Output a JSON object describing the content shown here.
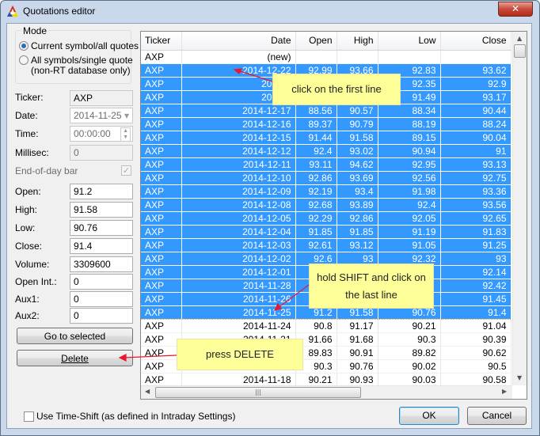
{
  "window": {
    "title": "Quotations editor",
    "close_label": "✕"
  },
  "mode": {
    "legend": "Mode",
    "options": [
      {
        "label": "Current symbol/all quotes",
        "selected": true
      },
      {
        "label": "All symbols/single quote",
        "label2": "(non-RT database only)",
        "selected": false
      }
    ]
  },
  "fields": {
    "ticker": {
      "label": "Ticker:",
      "value": "AXP"
    },
    "date": {
      "label": "Date:",
      "value": "2014-11-25"
    },
    "time": {
      "label": "Time:",
      "value": "00:00:00"
    },
    "millisec": {
      "label": "Millisec:",
      "value": "0"
    },
    "eod": {
      "label": "End-of-day bar",
      "checked": true
    },
    "open": {
      "label": "Open:",
      "value": "91.2"
    },
    "high": {
      "label": "High:",
      "value": "91.58"
    },
    "low": {
      "label": "Low:",
      "value": "90.76"
    },
    "close": {
      "label": "Close:",
      "value": "91.4"
    },
    "volume": {
      "label": "Volume:",
      "value": "3309600"
    },
    "openint": {
      "label": "Open Int.:",
      "value": "0"
    },
    "aux1": {
      "label": "Aux1:",
      "value": "0"
    },
    "aux2": {
      "label": "Aux2:",
      "value": "0"
    }
  },
  "buttons": {
    "goto": "Go to selected",
    "delete": "Delete",
    "ok": "OK",
    "cancel": "Cancel"
  },
  "timeshift": {
    "label": "Use Time-Shift (as defined in Intraday Settings)",
    "checked": false
  },
  "table": {
    "columns": [
      "Ticker",
      "Date",
      "Open",
      "High",
      "Low",
      "Close"
    ],
    "rows": [
      {
        "c": [
          "AXP",
          "(new)",
          "",
          "",
          "",
          ""
        ],
        "sel": false
      },
      {
        "c": [
          "AXP",
          "2014-12-22",
          "92.99",
          "93.66",
          "92.83",
          "93.62"
        ],
        "sel": true
      },
      {
        "c": [
          "AXP",
          "2014-1",
          "",
          "",
          "92.35",
          "92.9"
        ],
        "sel": true
      },
      {
        "c": [
          "AXP",
          "2014-1",
          "",
          "",
          "91.49",
          "93.17"
        ],
        "sel": true
      },
      {
        "c": [
          "AXP",
          "2014-12-17",
          "88.56",
          "90.57",
          "88.34",
          "90.44"
        ],
        "sel": true
      },
      {
        "c": [
          "AXP",
          "2014-12-16",
          "89.37",
          "90.79",
          "88.19",
          "88.24"
        ],
        "sel": true
      },
      {
        "c": [
          "AXP",
          "2014-12-15",
          "91.44",
          "91.58",
          "89.15",
          "90.04"
        ],
        "sel": true
      },
      {
        "c": [
          "AXP",
          "2014-12-12",
          "92.4",
          "93.02",
          "90.94",
          "91"
        ],
        "sel": true
      },
      {
        "c": [
          "AXP",
          "2014-12-11",
          "93.11",
          "94.62",
          "92.95",
          "93.13"
        ],
        "sel": true
      },
      {
        "c": [
          "AXP",
          "2014-12-10",
          "92.86",
          "93.69",
          "92.56",
          "92.75"
        ],
        "sel": true
      },
      {
        "c": [
          "AXP",
          "2014-12-09",
          "92.19",
          "93.4",
          "91.98",
          "93.36"
        ],
        "sel": true
      },
      {
        "c": [
          "AXP",
          "2014-12-08",
          "92.68",
          "93.89",
          "92.4",
          "93.56"
        ],
        "sel": true
      },
      {
        "c": [
          "AXP",
          "2014-12-05",
          "92.29",
          "92.86",
          "92.05",
          "92.65"
        ],
        "sel": true
      },
      {
        "c": [
          "AXP",
          "2014-12-04",
          "91.85",
          "91.85",
          "91.19",
          "91.83"
        ],
        "sel": true
      },
      {
        "c": [
          "AXP",
          "2014-12-03",
          "92.61",
          "93.12",
          "91.05",
          "91.25"
        ],
        "sel": true
      },
      {
        "c": [
          "AXP",
          "2014-12-02",
          "92.6",
          "93",
          "92.32",
          "93"
        ],
        "sel": true
      },
      {
        "c": [
          "AXP",
          "2014-12-01",
          "",
          "",
          "",
          "92.14"
        ],
        "sel": true
      },
      {
        "c": [
          "AXP",
          "2014-11-28",
          "",
          "",
          "",
          "92.42"
        ],
        "sel": true
      },
      {
        "c": [
          "AXP",
          "2014-11-26",
          "",
          "",
          "",
          "91.45"
        ],
        "sel": true
      },
      {
        "c": [
          "AXP",
          "2014-11-25",
          "91.2",
          "91.58",
          "90.76",
          "91.4"
        ],
        "sel": true,
        "cur": true
      },
      {
        "c": [
          "AXP",
          "2014-11-24",
          "90.8",
          "91.17",
          "90.21",
          "91.04"
        ],
        "sel": false
      },
      {
        "c": [
          "AXP",
          "2014-11-21",
          "91.66",
          "91.68",
          "90.3",
          "90.39"
        ],
        "sel": false
      },
      {
        "c": [
          "AXP",
          "",
          "89.83",
          "90.91",
          "89.82",
          "90.62"
        ],
        "sel": false
      },
      {
        "c": [
          "AXP",
          "",
          "90.3",
          "90.76",
          "90.02",
          "90.5"
        ],
        "sel": false
      },
      {
        "c": [
          "AXP",
          "2014-11-18",
          "90.21",
          "90.93",
          "90.03",
          "90.58"
        ],
        "sel": false
      }
    ]
  },
  "callouts": {
    "first": "click on the first line",
    "shift": "hold SHIFT and click on the last line",
    "delete": "press DELETE"
  },
  "colors": {
    "selection": "#3399ff",
    "callout": "#ffff99",
    "arrow": "#e8182e"
  }
}
